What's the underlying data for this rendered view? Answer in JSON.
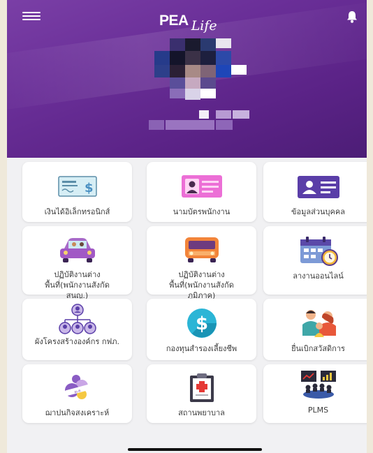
{
  "header": {
    "logo_main": "PEA",
    "logo_script": "Life"
  },
  "menu": [
    {
      "id": "e-money",
      "label": "เงินได้อิเล็กทรอนิกส์",
      "icon": "money-bill-icon"
    },
    {
      "id": "employee-card",
      "label": "นามบัตรพนักงาน",
      "icon": "business-card-icon"
    },
    {
      "id": "personal-info",
      "label": "ข้อมูลส่วนบุคคล",
      "icon": "id-card-icon"
    },
    {
      "id": "offsite-central",
      "label": "ปฏิบัติงานต่างพื้นที่(พนักงานสังกัดสนญ.)",
      "icon": "car-icon"
    },
    {
      "id": "offsite-region",
      "label": "ปฏิบัติงานต่างพื้นที่(พนักงานสังกัดภูมิภาค)",
      "icon": "bus-icon"
    },
    {
      "id": "leave-online",
      "label": "ลางานออนไลน์",
      "icon": "calendar-clock-icon"
    },
    {
      "id": "org-chart",
      "label": "ผังโครงสร้างองค์กร กฟภ.",
      "icon": "org-chart-icon"
    },
    {
      "id": "provident-fund",
      "label": "กองทุนสำรองเลี้ยงชีพ",
      "icon": "dollar-coin-icon"
    },
    {
      "id": "welfare",
      "label": "ยื่นเบิกสวัสดิการ",
      "icon": "family-icon"
    },
    {
      "id": "welfare-institute",
      "label": "ฌาปนกิจสงเคราะห์",
      "icon": "welfare-logo-icon"
    },
    {
      "id": "hospital",
      "label": "สถานพยาบาล",
      "icon": "clipboard-medical-icon"
    },
    {
      "id": "plms",
      "label": "PLMS",
      "icon": "meeting-chart-icon"
    }
  ]
}
